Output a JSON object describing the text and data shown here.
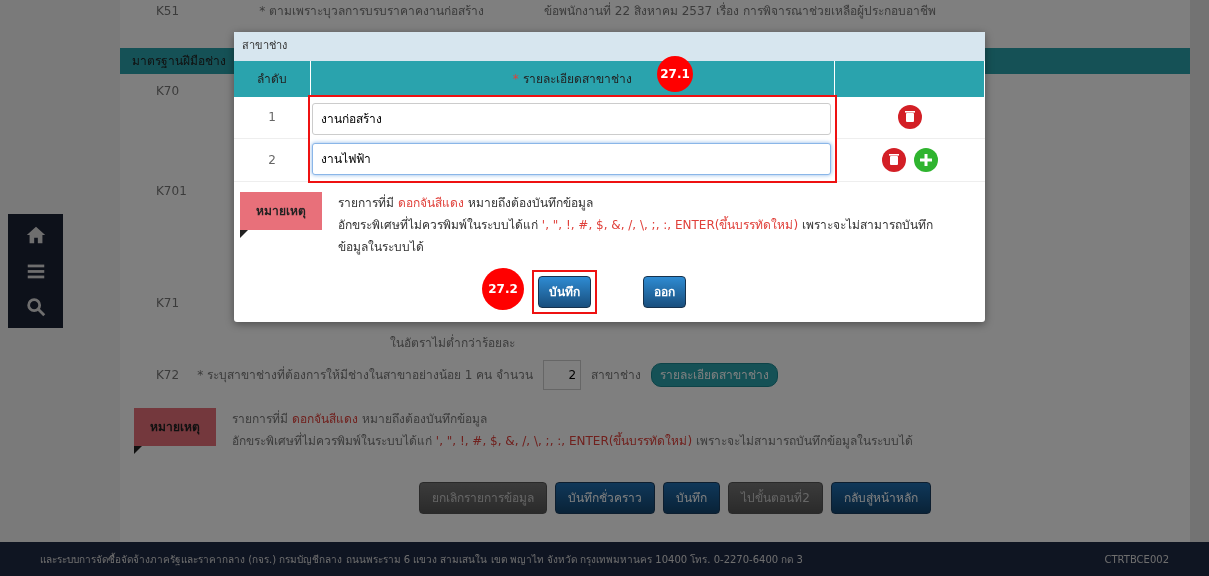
{
  "sidebar": {
    "items": [
      {
        "kind": "home"
      },
      {
        "kind": "menu"
      },
      {
        "kind": "search"
      }
    ]
  },
  "page": {
    "top_row": {
      "code": "K51",
      "label": "* ตามเพราะบุวลการบรบราคาคงานก่อสร้าง",
      "detail": "ข้อพนักงานที่ 22 สิงหาคม 2537 เรื่อง การพิจารณาช่วยเหลือผู้ประกอบอาชีพ"
    },
    "section_title": "มาตรฐานฝีมือช่าง",
    "codes": [
      {
        "code": "K70"
      },
      {
        "code": "K701"
      },
      {
        "code": "K71"
      }
    ],
    "rate_text": "ในอัตราไม่ต่ำกว่าร้อยละ",
    "k72": {
      "code": "K72",
      "label": "* ระบุสาขาช่างที่ต้องการให้มีช่างในสาขาอย่างน้อย 1 คน จำนวน",
      "count": "2",
      "unit": "สาขาช่าง",
      "button": "รายละเอียดสาขาช่าง"
    },
    "note": {
      "badge": "หมายเหตุ",
      "lines": [
        [
          {
            "text": "รายการที่มี ",
            "highlight": false
          },
          {
            "text": "ดอกจันสีแดง",
            "highlight": true
          },
          {
            "text": " หมายถึงต้องบันทึกข้อมูล",
            "highlight": false
          }
        ],
        [
          {
            "text": "อักขระพิเศษที่ไม่ควรพิมพ์ในระบบได้แก่ ",
            "highlight": false
          },
          {
            "text": "', \", !, #, $, &, /, \\, ;, :, ENTER(ขึ้นบรรทัดใหม่)",
            "highlight": true
          },
          {
            "text": " เพราะจะไม่สามารถบันทึกข้อมูลในระบบได้",
            "highlight": false
          }
        ]
      ]
    },
    "buttons": [
      {
        "label": "ยกเลิกรายการข้อมูล",
        "disabled": true
      },
      {
        "label": "บันทึกชั่วคราว",
        "disabled": false
      },
      {
        "label": "บันทึก",
        "disabled": false
      },
      {
        "label": "ไปขั้นตอนที่2",
        "disabled": true
      },
      {
        "label": "กลับสู่หน้าหลัก",
        "disabled": false
      }
    ]
  },
  "footer": {
    "text": "และระบบการจัดซื้อจัดจ้างภาครัฐและราคากลาง (กจร.) กรมบัญชีกลาง ถนนพระราม 6 แขวง สามเสนใน เขต พญาไท จังหวัด กรุงเทพมหานคร 10400 โทร. 0-2270-6400 กด 3",
    "code": "CTRTBCE002"
  },
  "dialog": {
    "title": "สาขาช่าง",
    "columns": [
      {
        "label": "ลำดับ"
      },
      {
        "label": "รายละเอียดสาขาช่าง",
        "mark": "*"
      }
    ],
    "rows": [
      {
        "no": "1",
        "value": "งานก่อสร้าง",
        "focused": false,
        "can_add": false
      },
      {
        "no": "2",
        "value": "งานไฟฟ้า",
        "focused": true,
        "can_add": true
      }
    ],
    "note": {
      "badge": "หมายเหตุ",
      "lines": [
        [
          {
            "text": "รายการที่มี ",
            "highlight": false
          },
          {
            "text": "ดอกจันสีแดง",
            "highlight": true
          },
          {
            "text": " หมายถึงต้องบันทึกข้อมูล",
            "highlight": false
          }
        ],
        [
          {
            "text": "อักขระพิเศษที่ไม่ควรพิมพ์ในระบบได้แก่ ",
            "highlight": false
          },
          {
            "text": "', \", !, #, $, &, /, \\, ;, :, ENTER(ขึ้นบรรทัดใหม่)",
            "highlight": true
          },
          {
            "text": " เพราะจะไม่สามารถบันทึกข้อมูลในระบบได้",
            "highlight": false
          }
        ]
      ]
    },
    "buttons": [
      "บันทึก",
      "ออก"
    ],
    "callouts": [
      "27.1",
      "27.2"
    ]
  }
}
